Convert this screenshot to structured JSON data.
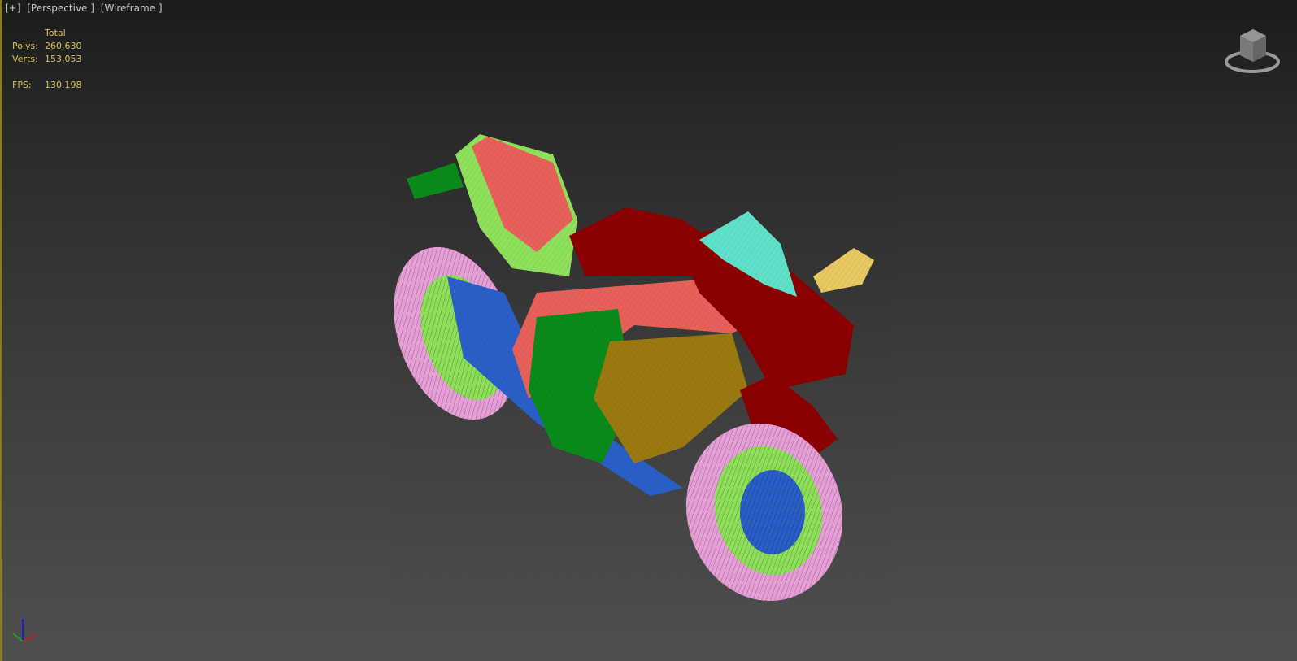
{
  "viewport": {
    "labels": [
      "[+]",
      "[Perspective ]",
      "[Wireframe ]"
    ],
    "stats": {
      "header": "Total",
      "rows": [
        {
          "key": "Polys:",
          "value": "260,630"
        },
        {
          "key": "Verts:",
          "value": "153,053"
        }
      ],
      "fps_key": "FPS:",
      "fps_value": "130.198"
    },
    "colors": {
      "stats": "#d6c35a",
      "red": "#8b0000",
      "salmon": "#e8605a",
      "lime": "#8fe05a",
      "green": "#0a8a1a",
      "blue": "#2a5fc8",
      "pink": "#e8a0d8",
      "yellow": "#e8c860",
      "cyan": "#60e0c8",
      "olive": "#9a7a10"
    },
    "axis": {
      "z": "z"
    }
  }
}
